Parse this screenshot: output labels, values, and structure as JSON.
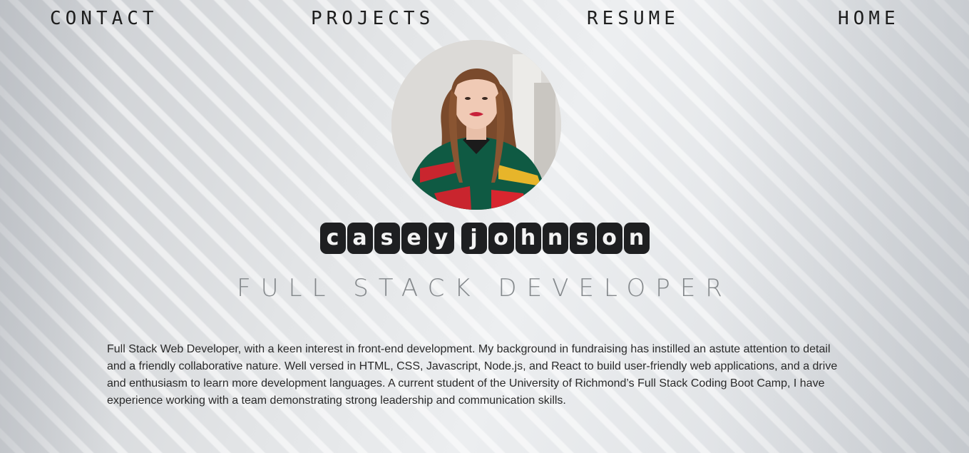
{
  "nav": {
    "contact": "CONTACT",
    "projects": "PROJECTS",
    "resume": "RESUME",
    "home": "HOME"
  },
  "profile": {
    "name": "Casey Johnson",
    "title": "FULL STACK DEVELOPER",
    "bio": "Full Stack Web Developer, with a keen interest in front-end development. My background in fundraising has instilled an astute attention to detail and a friendly collaborative nature. Well versed in HTML, CSS, Javascript, Node.js, and React to build user-friendly web applications, and a drive and enthusiasm to learn more development languages. A current student of the University of Richmond’s Full Stack Coding Boot Camp, I have experience working with a team demonstrating strong leadership and communication skills."
  },
  "colors": {
    "name_tile": "#1e1f21",
    "text": "#222222"
  }
}
